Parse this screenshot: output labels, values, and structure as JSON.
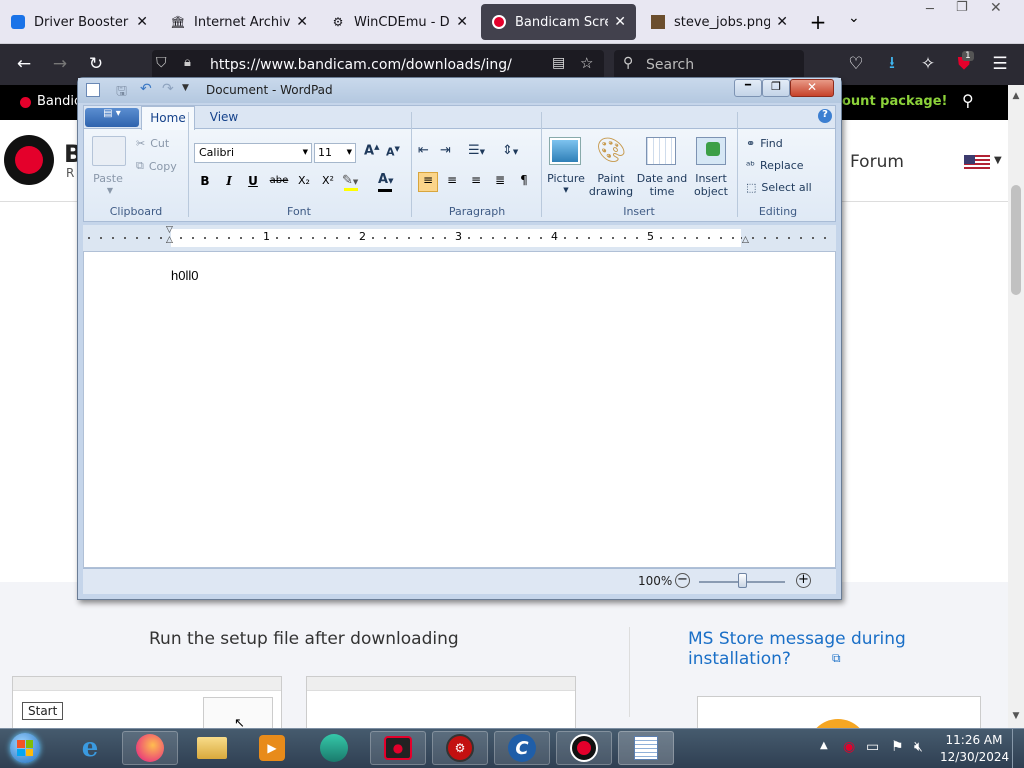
{
  "browser": {
    "tabs": [
      {
        "title": "Driver Booster Dow",
        "icon": "driver-booster-icon",
        "color": "#1a73e8"
      },
      {
        "title": "Internet Archive: Di",
        "icon": "archive-icon",
        "color": "#333333"
      },
      {
        "title": "WinCDEmu - Down",
        "icon": "gear-icon",
        "color": "#333333"
      },
      {
        "title": "Bandicam Screen R",
        "icon": "bandicam-icon",
        "color": "#e4002b"
      },
      {
        "title": "steve_jobs.png (PN",
        "icon": "image-icon",
        "color": "#6b4e2e"
      }
    ],
    "active_tab": 3,
    "new_tab": "+",
    "url": "https://www.bandicam.com/downloads/ing/",
    "search_placeholder": "Search",
    "extension_badge": "1"
  },
  "site": {
    "topbar_left": "Bandic",
    "topbar_promo": "ount package!",
    "logo_letter": "B",
    "logo_sub": "R",
    "nav_forum": "Forum",
    "step_left": "Run the setup file after downloading",
    "step_right": "MS Store message during installation?",
    "tooltip": "Start"
  },
  "wordpad": {
    "title": "Document - WordPad",
    "tabs": {
      "home": "Home",
      "view": "View"
    },
    "clipboard": {
      "paste": "Paste",
      "cut": "Cut",
      "copy": "Copy",
      "label": "Clipboard"
    },
    "font": {
      "family": "Calibri",
      "size": "11",
      "label": "Font",
      "bold": "B",
      "italic": "I",
      "underline": "U",
      "strike": "abe",
      "sub": "X₂",
      "sup": "X²",
      "color_a": "A"
    },
    "paragraph": {
      "label": "Paragraph"
    },
    "insert": {
      "picture": "Picture",
      "paint1": "Paint",
      "paint2": "drawing",
      "date1": "Date and",
      "date2": "time",
      "obj1": "Insert",
      "obj2": "object",
      "label": "Insert"
    },
    "editing": {
      "find": "Find",
      "replace": "Replace",
      "select_all": "Select all",
      "label": "Editing"
    },
    "ruler_numbers": [
      "1",
      "2",
      "3",
      "4",
      "5"
    ],
    "document_text": "h0ll0",
    "zoom": "100%"
  },
  "taskbar": {
    "time": "11:26 AM",
    "date": "12/30/2024"
  }
}
